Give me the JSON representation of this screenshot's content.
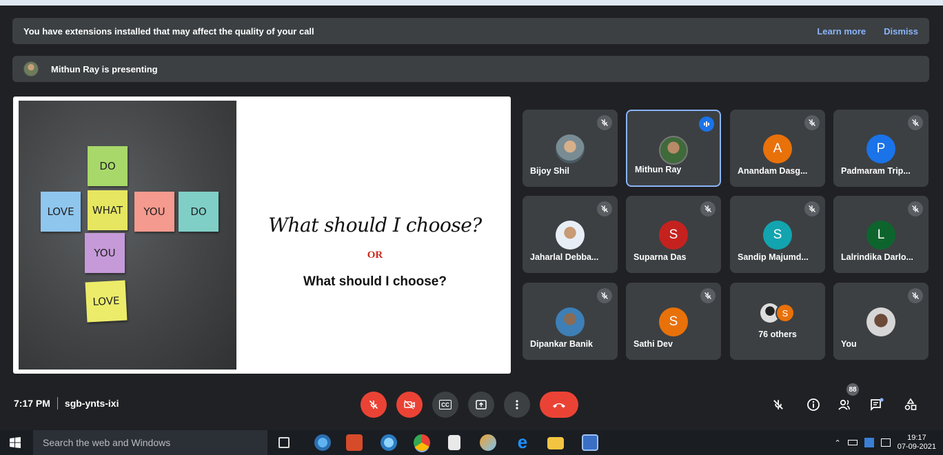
{
  "banner": {
    "extension_warning": "You have extensions installed that may affect the quality of your call",
    "learn_more": "Learn more",
    "dismiss": "Dismiss"
  },
  "presenting": {
    "text": "Mithun Ray is presenting"
  },
  "slide": {
    "notes": [
      "DO",
      "LOVE",
      "WHAT",
      "YOU",
      "DO",
      "YOU",
      "LOVE"
    ],
    "script_title": "What should I choose?",
    "or_text": "OR",
    "plain_title": "What should I choose?"
  },
  "participants": [
    {
      "name": "Bijoy Shil",
      "initial": ""
    },
    {
      "name": "Mithun Ray",
      "initial": ""
    },
    {
      "name": "Anandam Dasg...",
      "initial": "A",
      "color": "#e8710a"
    },
    {
      "name": "Padmaram Trip...",
      "initial": "P",
      "color": "#1a73e8"
    },
    {
      "name": "Jaharlal Debba...",
      "initial": ""
    },
    {
      "name": "Suparna Das",
      "initial": "S",
      "color": "#c5221f"
    },
    {
      "name": "Sandip Majumd...",
      "initial": "S",
      "color": "#12a4af"
    },
    {
      "name": "Lalrindika Darlo...",
      "initial": "L",
      "color": "#0d652d"
    },
    {
      "name": "Dipankar Banik",
      "initial": ""
    },
    {
      "name": "Sathi Dev",
      "initial": "S",
      "color": "#e8710a"
    },
    {
      "name": "",
      "initial": ""
    },
    {
      "name": "You",
      "initial": ""
    }
  ],
  "others": {
    "count_label": "76 others",
    "avatar_initial": "S"
  },
  "meeting": {
    "time": "7:17 PM",
    "code": "sgb-ynts-ixi"
  },
  "controls": {
    "cc_label": "CC",
    "people_count": "88"
  },
  "taskbar": {
    "search_placeholder": "Search the web and Windows",
    "time": "19:17",
    "date": "07-09-2021"
  }
}
